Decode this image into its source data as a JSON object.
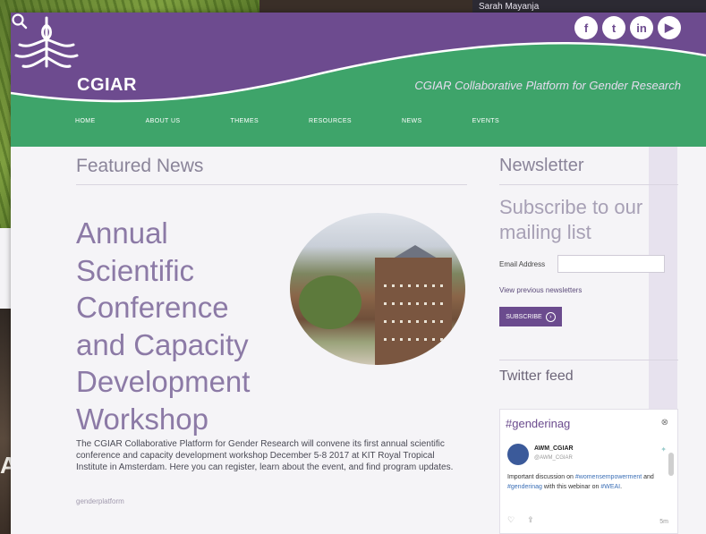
{
  "background": {
    "caption": "Sarah Mayanja",
    "edge_letter": "A"
  },
  "colors": {
    "purple": "#6d4b8f",
    "green": "#3ea46a",
    "text_purple": "#8c7aa6"
  },
  "header": {
    "logo_text": "CGIAR",
    "platform_title": "CGIAR Collaborative Platform for Gender Research",
    "social": [
      {
        "icon": "facebook-icon",
        "glyph": "f"
      },
      {
        "icon": "twitter-icon",
        "glyph": "t"
      },
      {
        "icon": "linkedin-icon",
        "glyph": "in"
      },
      {
        "icon": "youtube-icon",
        "glyph": "▶"
      }
    ],
    "nav": [
      "HOME",
      "ABOUT US",
      "THEMES",
      "RESOURCES",
      "NEWS",
      "EVENTS"
    ]
  },
  "main": {
    "section_title": "Featured News",
    "headline": "Annual Scientific Conference and Capacity Development Workshop",
    "body": "The CGIAR Collaborative Platform for Gender Research will convene its first annual scientific conference and capacity development workshop December 5-8 2017 at KIT Royal Tropical Institute in Amsterdam. Here you can register, learn about the event, and find program updates.",
    "tag": "genderplatform"
  },
  "sidebar": {
    "newsletter_title": "Newsletter",
    "subscribe_heading": "Subscribe to our mailing list",
    "email_label": "Email Address",
    "email_value": "",
    "previous_link": "View previous newsletters",
    "subscribe_button": "SUBSCRIBE",
    "twitter_title": "Twitter feed"
  },
  "twitter": {
    "hashtag": "#genderinag",
    "close": "⊗",
    "author": "AWM_CGIAR",
    "handle": "@AWM_CGIAR",
    "text_1": "Important discussion on ",
    "hashtag_1": "#womensempowerment",
    "text_2": " and ",
    "hashtag_2": "#genderinag",
    "text_3": " with this webinar on ",
    "hashtag_3": "#WEAI",
    "text_4": ".",
    "time": "5m"
  }
}
